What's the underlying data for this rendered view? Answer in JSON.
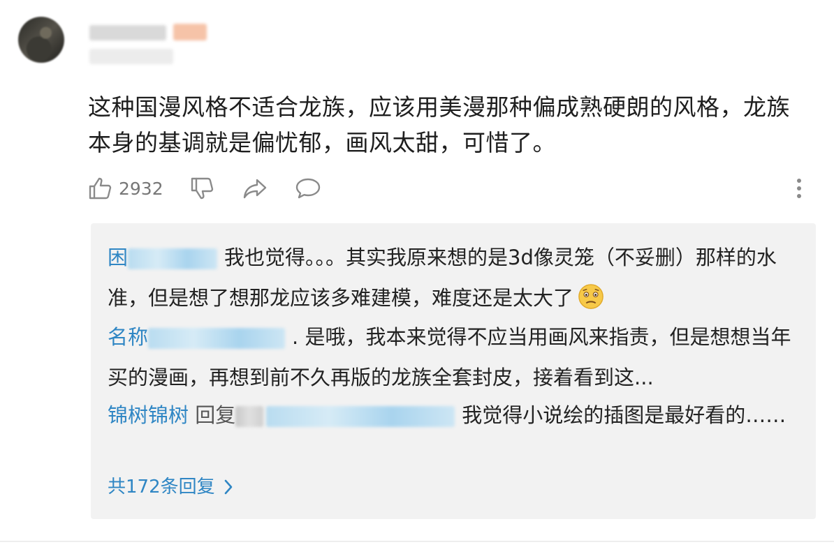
{
  "comment": {
    "text": "这种国漫风格不适合龙族，应该用美漫那种偏成熟硬朗的风格，龙族本身的基调就是偏忧郁，画风太甜，可惜了。",
    "likes": "2932",
    "icons": [
      "thumbs-up-icon",
      "thumbs-down-icon",
      "share-icon",
      "comment-icon",
      "more-icon"
    ]
  },
  "replies": [
    {
      "name": "困",
      "text": "我也觉得。。。其实我原来想的是3d像灵笼（不妥删）那样的水准，但是想了想那龙应该多难建模，难度还是太大了"
    },
    {
      "name": "名称",
      "text": ". 是哦，我本来觉得不应当用画风来指责，但是想想当年买的漫画，再想到前不久再版的龙族全套封皮，接着看到这..."
    },
    {
      "name": "锦树锦树",
      "mid": "回复",
      "text": "我觉得小说绘的插图是最好看的……"
    }
  ],
  "view_all_label": "共172条回复",
  "colors": {
    "link": "#2f86c4",
    "reply_bg": "#f2f2f2",
    "icon": "#8a8a8a"
  }
}
